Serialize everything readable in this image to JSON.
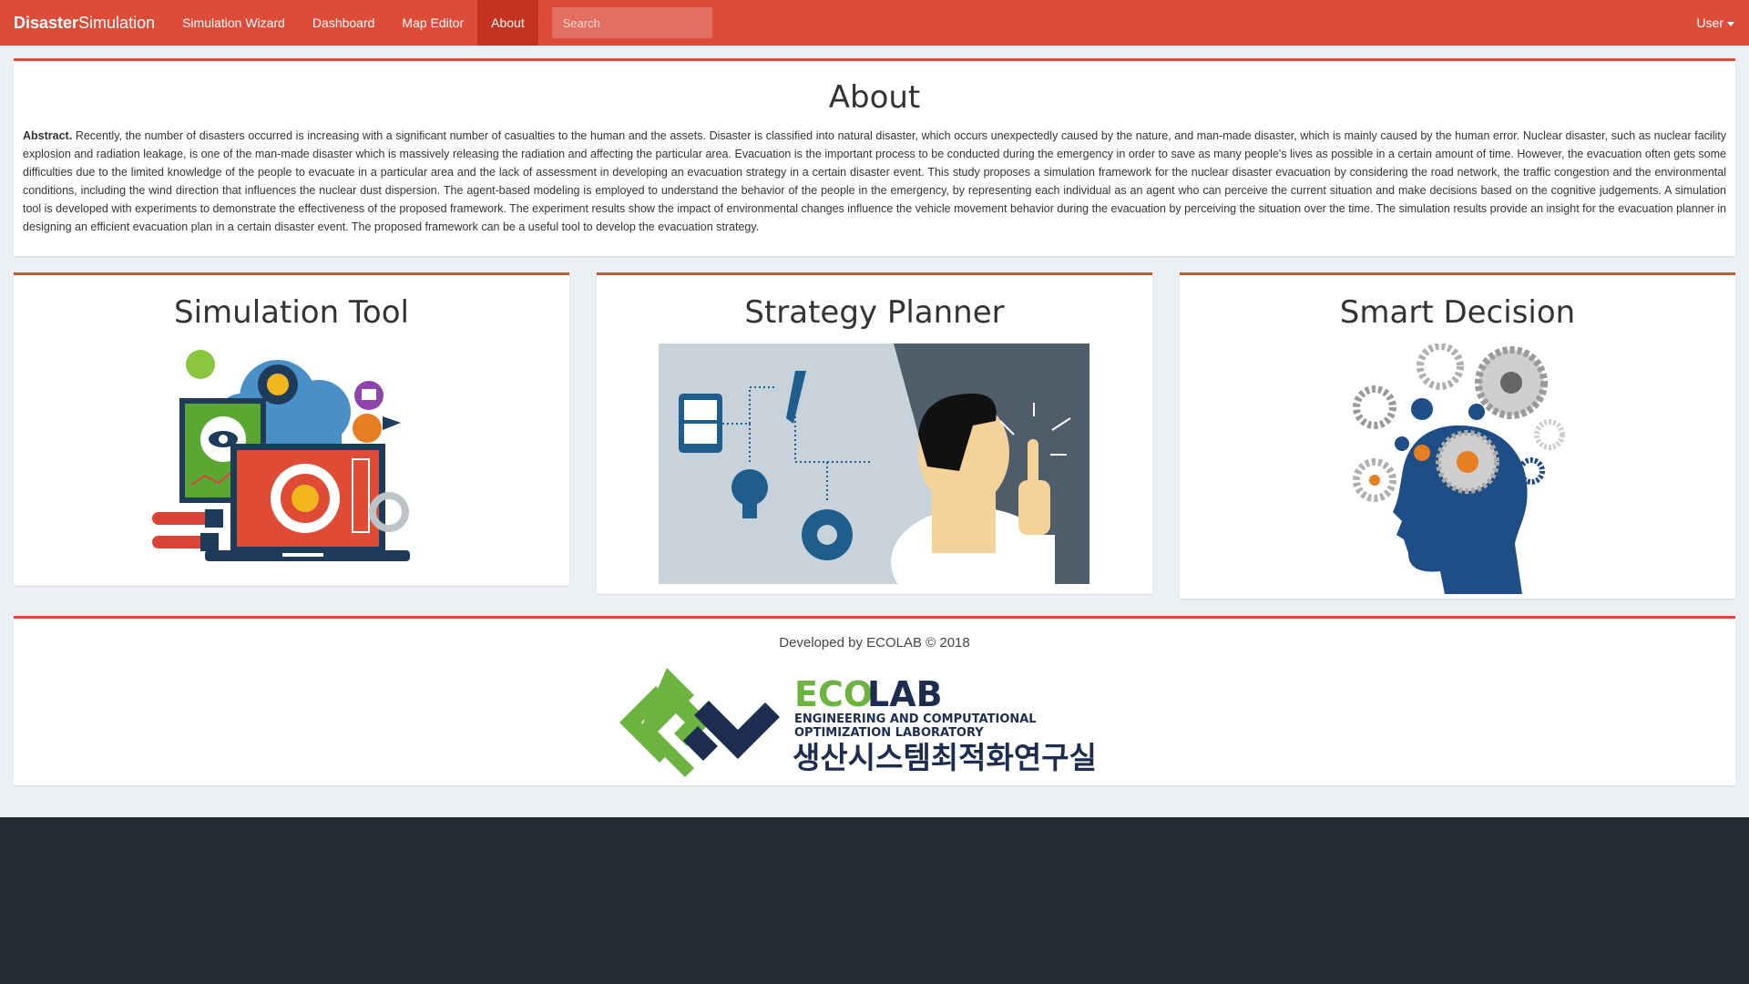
{
  "navbar": {
    "brand_bold": "Disaster",
    "brand_rest": "Simulation",
    "items": [
      {
        "label": "Simulation Wizard",
        "active": false
      },
      {
        "label": "Dashboard",
        "active": false
      },
      {
        "label": "Map Editor",
        "active": false
      },
      {
        "label": "About",
        "active": true
      }
    ],
    "search_placeholder": "Search",
    "user_label": "User"
  },
  "about": {
    "title": "About",
    "abstract_label": "Abstract.",
    "abstract_text": "Recently, the number of disasters occurred is increasing with a significant number of casualties to the human and the assets. Disaster is classified into natural disaster, which occurs unexpectedly caused by the nature, and man-made disaster, which is mainly caused by the human error. Nuclear disaster, such as nuclear facility explosion and radiation leakage, is one of the man-made disaster which is massively releasing the radiation and affecting the particular area. Evacuation is the important process to be conducted during the emergency in order to save as many people's lives as possible in a certain amount of time. However, the evacuation often gets some difficulties due to the limited knowledge of the people to evacuate in a particular area and the lack of assessment in developing an evacuation strategy in a certain disaster event. This study proposes a simulation framework for the nuclear disaster evacuation by considering the road network, the traffic congestion and the environmental conditions, including the wind direction that influences the nuclear dust dispersion. The agent-based modeling is employed to understand the behavior of the people in the emergency, by representing each individual as an agent who can perceive the current situation and make decisions based on the cognitive judgements. A simulation tool is developed with experiments to demonstrate the effectiveness of the proposed framework. The experiment results show the impact of environmental changes influence the vehicle movement behavior during the evacuation by perceiving the situation over the time. The simulation results provide an insight for the evacuation planner in designing an efficient evacuation plan in a certain disaster event. The proposed framework can be a useful tool to develop the evacuation strategy."
  },
  "cards": [
    {
      "title": "Simulation Tool",
      "image": "simulation-tool-illustration"
    },
    {
      "title": "Strategy Planner",
      "image": "strategy-planner-illustration"
    },
    {
      "title": "Smart Decision",
      "image": "smart-decision-illustration"
    }
  ],
  "footer": {
    "credit": "Developed by ECOLAB © 2018",
    "logo_eco": "ECO",
    "logo_lab": "LAB",
    "logo_line1": "ENGINEERING AND COMPUTATIONAL",
    "logo_line2": "OPTIMIZATION LABORATORY",
    "logo_korean": "생산시스템최적화연구실"
  },
  "colors": {
    "accent": "#dd4b39",
    "accent_dark": "#c23321",
    "background": "#ecf0f5",
    "footer_dark": "#222d32",
    "logo_green": "#6cb33f",
    "logo_navy": "#1d2d50"
  }
}
